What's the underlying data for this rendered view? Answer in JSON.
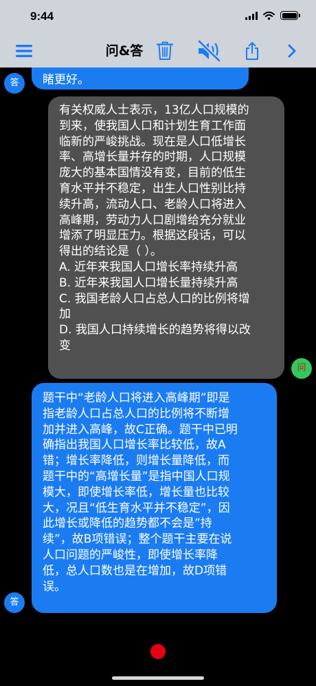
{
  "status": {
    "time": "9:44"
  },
  "toolbar": {
    "title": "问&答"
  },
  "avatars": {
    "answer": "答",
    "question": "问"
  },
  "messages": [
    {
      "role": "answer",
      "lines": [
        "...",
        "睹更好。"
      ]
    },
    {
      "role": "question",
      "lines": [
        "有关权威人士表示，13亿人口规模的",
        "到来，使我国人口和计划生育工作面",
        "临新的严峻挑战。现在是人口低增长",
        "率、高增长量并存的时期，人口规模",
        "庞大的基本国情没有变，目前的低生",
        "育水平并不稳定，出生人口性别比持",
        "续升高，流动人口、老龄人口将进入",
        "高峰期，劳动力人口剧增给充分就业",
        "增添了明显压力。根据这段话，可以",
        "得出的结论是（ ）。",
        "A. 近年来我国人口增长率持续升高",
        "B. 近年来我国人口增长量持续升高",
        "C. 我国老龄人口占总人口的比例将增",
        "加",
        "D. 我国人口持续增长的趋势将得以改",
        "变"
      ]
    },
    {
      "role": "answer",
      "lines": [
        "题干中“老龄人口将进入高峰期”即是",
        "指老龄人口占总人口的比例将不断增",
        "加并进入高峰，故C正确。题干中已明",
        "确指出我国人口增长率比较低，故A",
        "错；增长率降低，则增长量降低，而",
        "题干中的“高增长量”是指中国人口规",
        "模大，即使增长率低，增长量也比较",
        "大，况且“低生育水平并不稳定”，因",
        "此增长或降低的趋势都不会是”持",
        "续”，故B项错误；整个题干主要在说",
        "人口问题的严峻性，即使增长率降",
        "低，总人口数也是在增加，故D项错",
        "误。"
      ]
    }
  ],
  "colors": {
    "answer_bubble": "#1b7cf2",
    "question_bubble": "#505050",
    "toolbar": "#cfd3da",
    "accent": "#1b7cf2",
    "record": "#e60012"
  },
  "icons": {
    "menu": "hamburger-icon",
    "delete": "trash-icon",
    "mute": "speaker-muted-icon",
    "share": "share-icon",
    "next": "chevron-right-icon"
  }
}
